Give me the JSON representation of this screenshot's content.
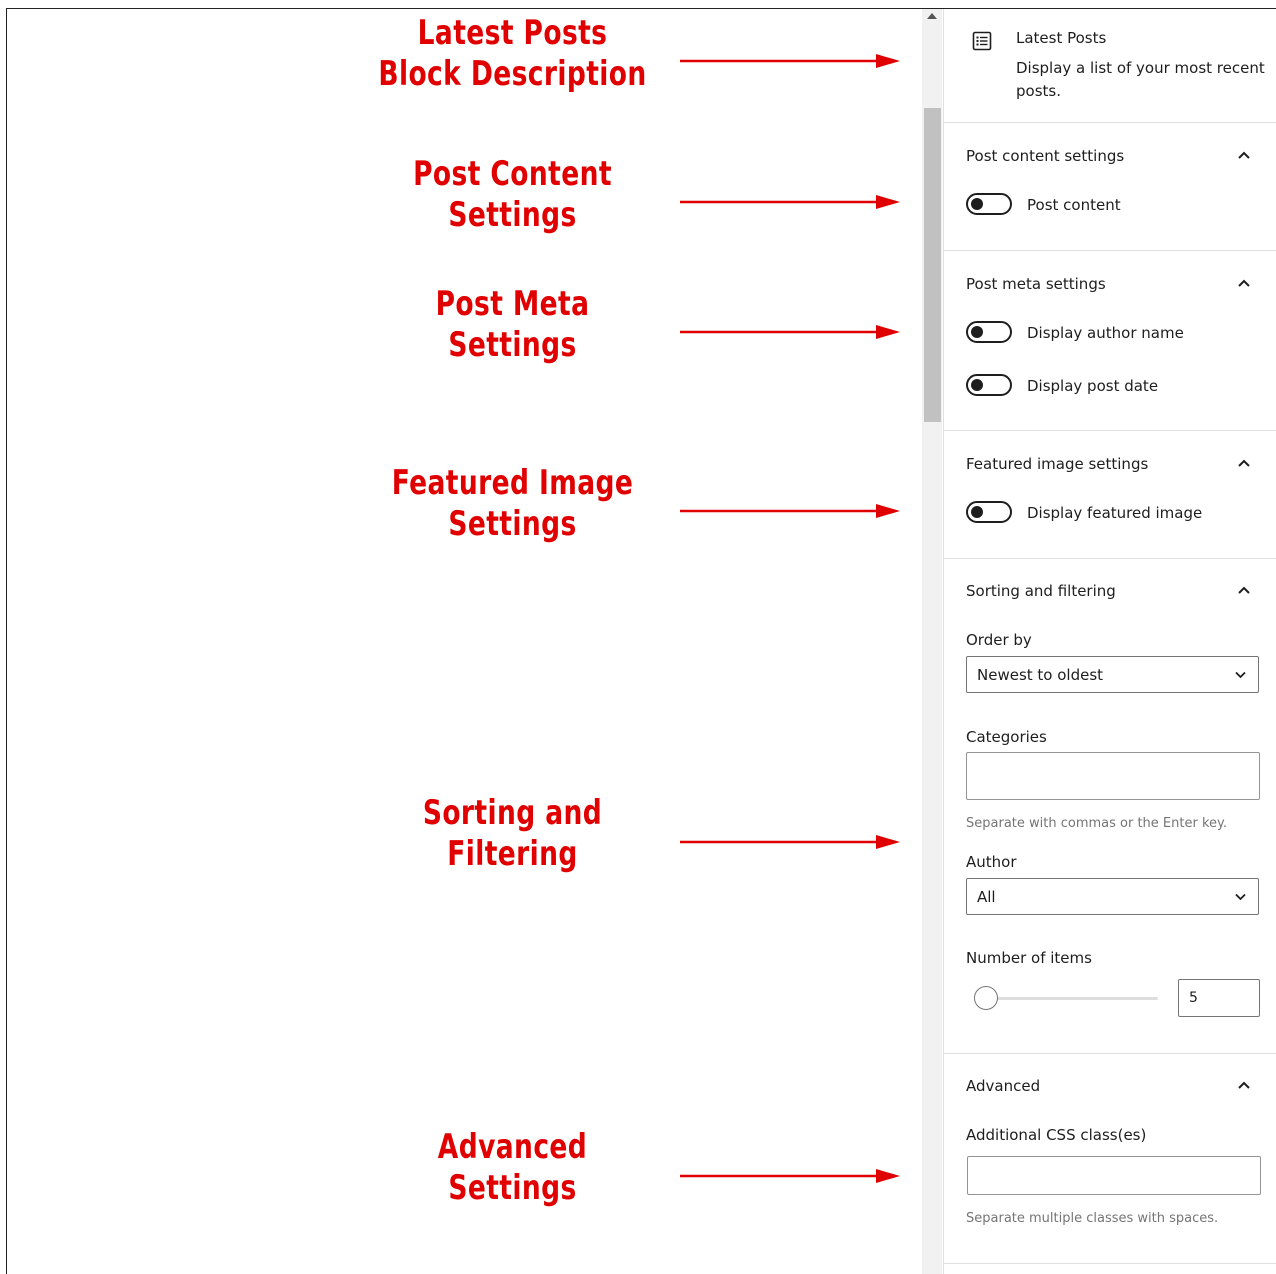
{
  "annotations": [
    {
      "lines": [
        "Latest Posts",
        "Block Description"
      ]
    },
    {
      "lines": [
        "Post Content",
        "Settings"
      ]
    },
    {
      "lines": [
        "Post Meta",
        "Settings"
      ]
    },
    {
      "lines": [
        "Featured Image",
        "Settings"
      ]
    },
    {
      "lines": [
        "Sorting and",
        "Filtering"
      ]
    },
    {
      "lines": [
        "Advanced",
        "Settings"
      ]
    }
  ],
  "colors": {
    "annotation": "#e00000",
    "text": "#1e1e1e",
    "muted": "#757575"
  },
  "block": {
    "title": "Latest Posts",
    "description": "Display a list of your most recent posts.",
    "icon": "list-view-icon"
  },
  "post_content": {
    "title": "Post content settings",
    "toggle_label": "Post content",
    "enabled": false
  },
  "post_meta": {
    "title": "Post meta settings",
    "author_label": "Display author name",
    "author_enabled": false,
    "date_label": "Display post date",
    "date_enabled": false
  },
  "featured_image": {
    "title": "Featured image settings",
    "toggle_label": "Display featured image",
    "enabled": false
  },
  "sorting": {
    "title": "Sorting and filtering",
    "order_label": "Order by",
    "order_value": "Newest to oldest",
    "categories_label": "Categories",
    "categories_help": "Separate with commas or the Enter key.",
    "author_label": "Author",
    "author_value": "All",
    "items_label": "Number of items",
    "items_value": "5"
  },
  "advanced": {
    "title": "Advanced",
    "css_label": "Additional CSS class(es)",
    "css_help": "Separate multiple classes with spaces."
  }
}
